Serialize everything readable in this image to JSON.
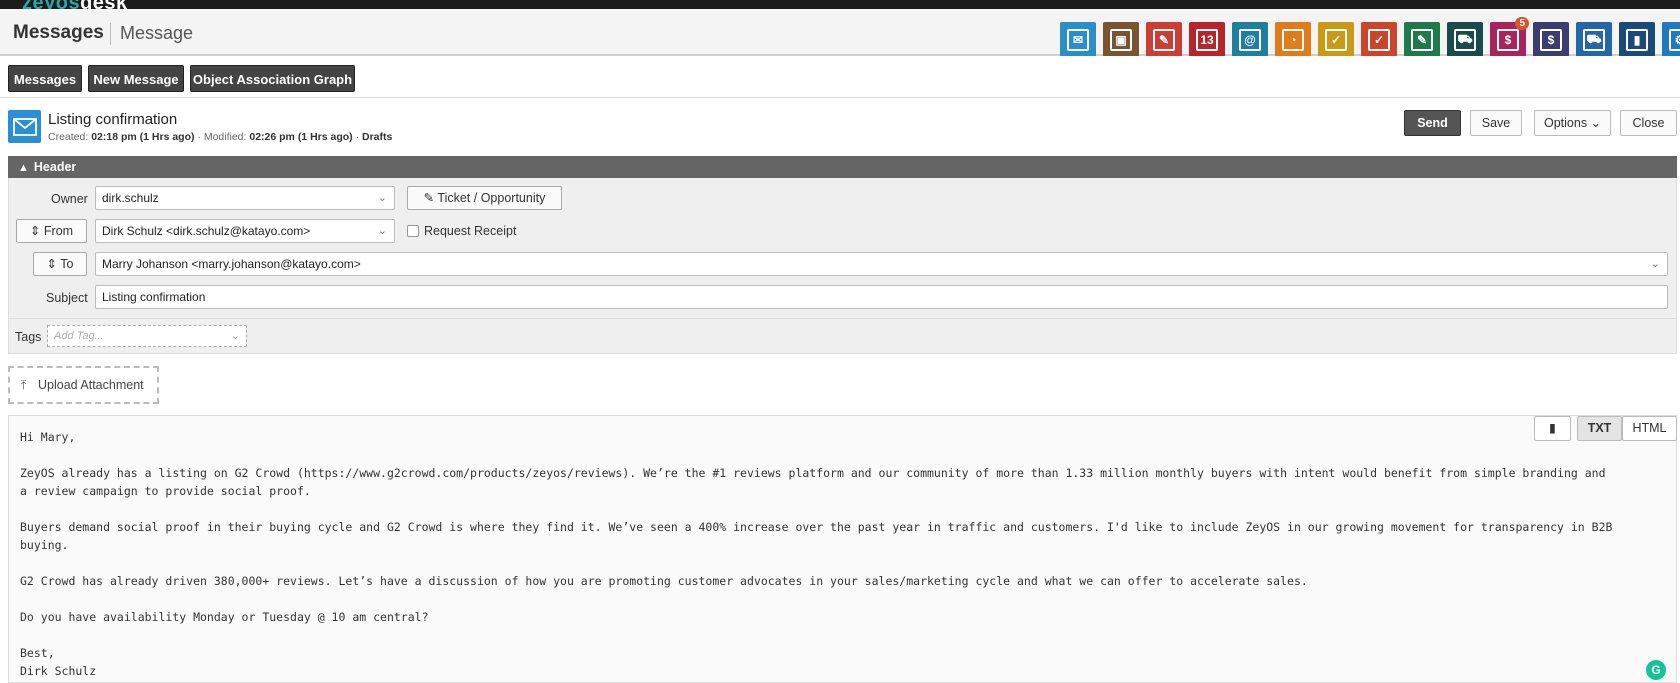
{
  "app": {
    "logo_a": "zeyos",
    "logo_b": "desk"
  },
  "header": {
    "title": "Messages",
    "subtitle": "Message"
  },
  "apps": [
    {
      "icon": "envelope-icon",
      "color": "#2a8fc6",
      "glyph": "✉",
      "badge": ""
    },
    {
      "icon": "contacts-icon",
      "color": "#7a5330",
      "glyph": "▣",
      "badge": ""
    },
    {
      "icon": "document-icon",
      "color": "#cc3e33",
      "glyph": "✎",
      "badge": ""
    },
    {
      "icon": "calendar-icon",
      "color": "#b4262b",
      "glyph": "13",
      "badge": ""
    },
    {
      "icon": "address-book-icon",
      "color": "#1f7fa0",
      "glyph": "@",
      "badge": ""
    },
    {
      "icon": "stopwatch-icon",
      "color": "#e07a1a",
      "glyph": "◔",
      "badge": ""
    },
    {
      "icon": "tasks-icon",
      "color": "#c99a1a",
      "glyph": "✓",
      "badge": ""
    },
    {
      "icon": "folder-check-icon",
      "color": "#c9452c",
      "glyph": "✓",
      "badge": ""
    },
    {
      "icon": "edit-icon",
      "color": "#1e7a4a",
      "glyph": "✎",
      "badge": ""
    },
    {
      "icon": "shopping-cart-icon",
      "color": "#1a4a4a",
      "glyph": "⛟",
      "badge": ""
    },
    {
      "icon": "cash-register-icon",
      "color": "#a8245a",
      "glyph": "$",
      "badge": "5"
    },
    {
      "icon": "dollar-icon",
      "color": "#3a3d6e",
      "glyph": "$",
      "badge": ""
    },
    {
      "icon": "truck-icon",
      "color": "#2466a8",
      "glyph": "⛟",
      "badge": ""
    },
    {
      "icon": "bookmark-icon",
      "color": "#1c4a78",
      "glyph": "▮",
      "badge": ""
    },
    {
      "icon": "gear-icon",
      "color": "#1e7ac4",
      "glyph": "⚙",
      "badge": ""
    }
  ],
  "nav": {
    "messages": "Messages",
    "new_message": "New Message",
    "graph": "Object Association Graph"
  },
  "message": {
    "title": "Listing confirmation",
    "created_label": "Created:",
    "created": "02:18 pm (1 Hrs ago)",
    "modified_label": "· Modified:",
    "modified": "02:26 pm (1 Hrs ago)",
    "sep": "·",
    "status": "Drafts"
  },
  "actions": {
    "send": "Send",
    "save": "Save",
    "options": "Options ⌄",
    "close": "Close"
  },
  "section": {
    "header": "Header"
  },
  "form": {
    "owner_label": "Owner",
    "owner_value": "dirk.schulz",
    "ticket_button": "Ticket / Opportunity",
    "from_button": "From",
    "from_value": "Dirk Schulz <dirk.schulz@katayo.com>",
    "receipt_label": "Request Receipt",
    "to_button": "To",
    "to_value": "Marry Johanson <marry.johanson@katayo.com>",
    "subject_label": "Subject",
    "subject_value": "Listing confirmation",
    "tags_label": "Tags",
    "tags_placeholder": "Add Tag..."
  },
  "upload": {
    "label": "Upload Attachment"
  },
  "editor": {
    "txt": "TXT",
    "html": "HTML",
    "body": "Hi Mary,\n\nZeyOS already has a listing on G2 Crowd (https://www.g2crowd.com/products/zeyos/reviews). We’re the #1 reviews platform and our community of more than 1.33 million monthly buyers with intent would benefit from simple branding and\na review campaign to provide social proof.\n\nBuyers demand social proof in their buying cycle and G2 Crowd is where they find it. We’ve seen a 400% increase over the past year in traffic and customers. I'd like to include ZeyOS in our growing movement for transparency in B2B\nbuying.\n\nG2 Crowd has already driven 380,000+ reviews. Let’s have a discussion of how you are promoting customer advocates in your sales/marketing cycle and what we can offer to accelerate sales.\n\nDo you have availability Monday or Tuesday @ 10 am central?\n\nBest,\nDirk Schulz"
  }
}
